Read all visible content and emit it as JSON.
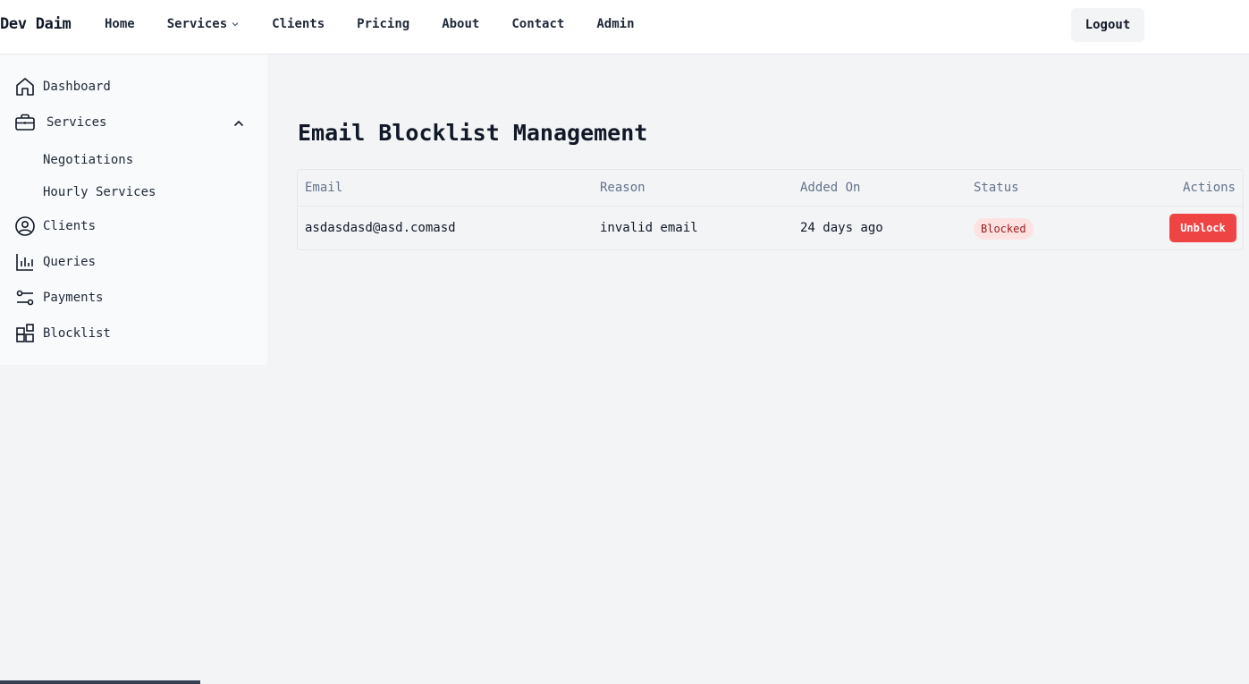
{
  "brand": "Dev Daim",
  "nav": {
    "items": [
      {
        "label": "Home"
      },
      {
        "label": "Services",
        "has_dropdown": true
      },
      {
        "label": "Clients"
      },
      {
        "label": "Pricing"
      },
      {
        "label": "About"
      },
      {
        "label": "Contact"
      },
      {
        "label": "Admin"
      }
    ],
    "logout_label": "Logout"
  },
  "sidebar": {
    "items": [
      {
        "label": "Dashboard",
        "icon": "home-icon"
      },
      {
        "label": "Services",
        "icon": "briefcase-icon",
        "expanded": true,
        "children": [
          {
            "label": "Negotiations"
          },
          {
            "label": "Hourly Services"
          }
        ]
      },
      {
        "label": "Clients",
        "icon": "user-circle-icon"
      },
      {
        "label": "Queries",
        "icon": "bar-chart-icon"
      },
      {
        "label": "Payments",
        "icon": "adjustments-icon"
      },
      {
        "label": "Blocklist",
        "icon": "squares-plus-icon"
      }
    ]
  },
  "main": {
    "title": "Email Blocklist Management",
    "table": {
      "headers": {
        "email": "Email",
        "reason": "Reason",
        "added_on": "Added On",
        "status": "Status",
        "actions": "Actions"
      },
      "rows": [
        {
          "email": "asdasdasd@asd.comasd",
          "reason": "invalid email",
          "added_on": "24 days ago",
          "status": "Blocked",
          "action_label": "Unblock"
        }
      ]
    }
  },
  "progress": {
    "fraction": 0.16
  },
  "colors": {
    "accent_danger": "#ef4444",
    "badge_bg": "#fee2e2",
    "badge_text": "#991b1b"
  }
}
